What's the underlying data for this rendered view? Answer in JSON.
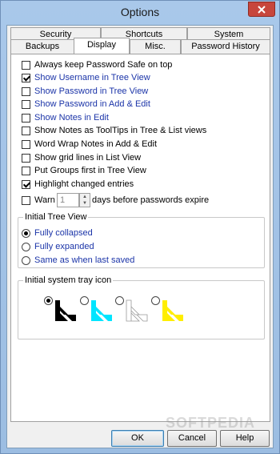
{
  "window": {
    "title": "Options"
  },
  "tabs": {
    "row_top": [
      "Security",
      "Shortcuts",
      "System"
    ],
    "row_bottom": [
      "Backups",
      "Display",
      "Misc.",
      "Password History"
    ],
    "active": "Display"
  },
  "options": [
    {
      "label": "Always keep Password Safe on top",
      "checked": false
    },
    {
      "label": "Show Username in Tree View",
      "checked": true
    },
    {
      "label": "Show Password in Tree View",
      "checked": false
    },
    {
      "label": "Show Password in Add & Edit",
      "checked": false
    },
    {
      "label": "Show Notes in Edit",
      "checked": false
    },
    {
      "label": "Show Notes as ToolTips in Tree & List views",
      "checked": false
    },
    {
      "label": "Word Wrap Notes in Add & Edit",
      "checked": false
    },
    {
      "label": "Show grid lines in List View",
      "checked": false
    },
    {
      "label": "Put Groups first in Tree View",
      "checked": false
    },
    {
      "label": "Highlight changed entries",
      "checked": true
    }
  ],
  "warn": {
    "label": "Warn",
    "checked": false,
    "days_value": "1",
    "suffix": "days before passwords expire"
  },
  "initial_tree_view": {
    "legend": "Initial Tree View",
    "choices": [
      "Fully collapsed",
      "Fully expanded",
      "Same as when last saved"
    ],
    "selected": "Fully collapsed"
  },
  "tray_icon": {
    "legend": "Initial system tray icon",
    "choices": [
      {
        "icon": "tray-icon-black",
        "color": "#000000",
        "selected": true
      },
      {
        "icon": "tray-icon-cyan",
        "color": "#00e5ff",
        "selected": false
      },
      {
        "icon": "tray-icon-white",
        "color": "#ffffff",
        "selected": false
      },
      {
        "icon": "tray-icon-yellow",
        "color": "#ffee00",
        "selected": false
      }
    ]
  },
  "buttons": {
    "ok": "OK",
    "cancel": "Cancel",
    "help": "Help"
  },
  "watermark": "SOFTPEDIA"
}
